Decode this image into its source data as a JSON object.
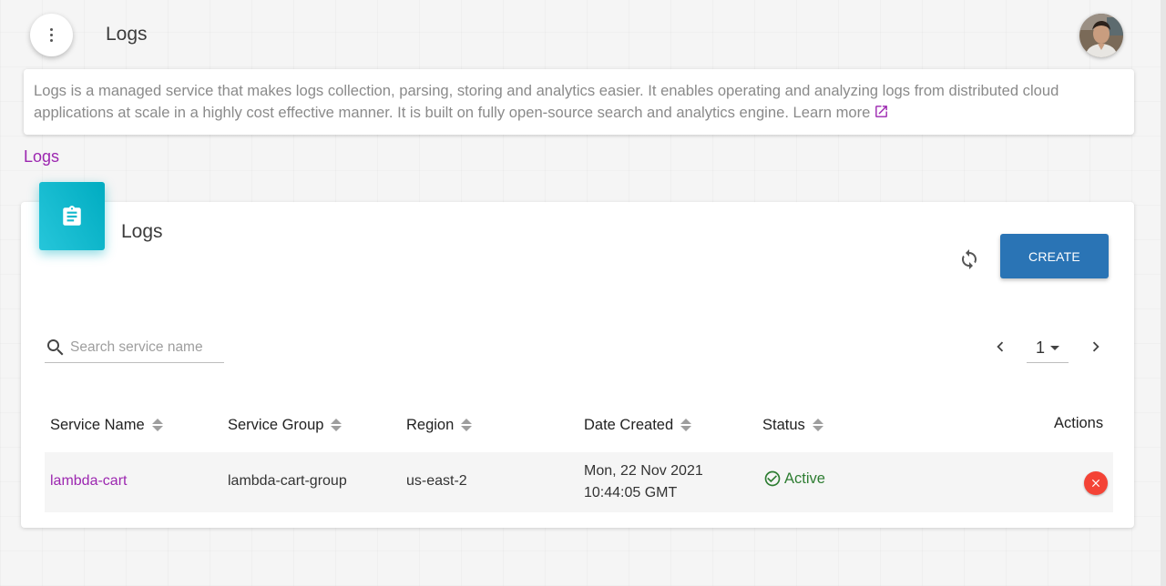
{
  "header": {
    "title": "Logs",
    "menu_icon": "more-vert-icon",
    "avatar": "user-avatar"
  },
  "description": {
    "text": "Logs is a managed service that makes logs collection, parsing, storing and analytics easier. It enables operating and analyzing logs from distributed cloud applications at scale in a highly cost effective manner. It is built on fully open-source search and analytics engine.",
    "learn_more": "Learn more",
    "link_icon": "external-link-icon"
  },
  "breadcrumb": "Logs",
  "card": {
    "title": "Logs",
    "icon": "clipboard-icon",
    "refresh_icon": "refresh-icon",
    "create_label": "CREATE",
    "search_placeholder": "Search service name",
    "page": "1"
  },
  "table": {
    "columns": [
      "Service Name",
      "Service Group",
      "Region",
      "Date Created",
      "Status"
    ],
    "actions_label": "Actions",
    "rows": [
      {
        "service_name": "lambda-cart",
        "service_group": "lambda-cart-group",
        "region": "us-east-2",
        "date_line1": "Mon, 22 Nov 2021",
        "date_line2": "10:44:05 GMT",
        "status": "Active",
        "action_icon": "delete-icon"
      }
    ]
  },
  "colors": {
    "accent_purple": "#9c27b0",
    "primary_blue": "#2a74b5",
    "icon_teal": "#26c6da",
    "status_green": "#2e7d32",
    "delete_red": "#f44336"
  }
}
